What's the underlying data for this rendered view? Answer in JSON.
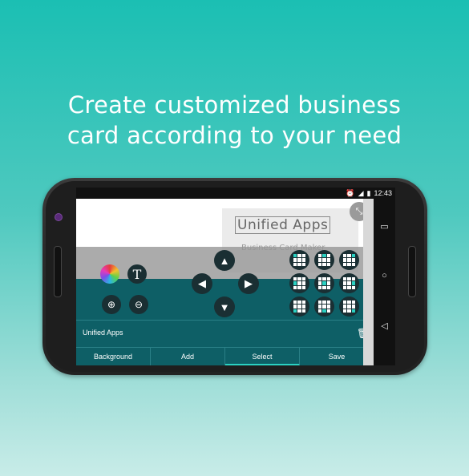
{
  "headline": {
    "line1": "Create customized business",
    "line2": "card according to your need"
  },
  "status": {
    "time": "12:43"
  },
  "card": {
    "title": "Unified Apps",
    "subtitle": "Business Card Maker"
  },
  "editor": {
    "text_label": "Unified Apps"
  },
  "tabs": [
    {
      "label": "Background"
    },
    {
      "label": "Add"
    },
    {
      "label": "Select"
    },
    {
      "label": "Save"
    }
  ],
  "colors": {
    "accent": "#2ad1c2",
    "panel": "#0e5f66",
    "bg_top": "#1bbfb3"
  },
  "icons": {
    "color": "color-wheel-icon",
    "text": "text-icon",
    "zoom_in": "zoom-in-icon",
    "zoom_out": "zoom-out-icon",
    "up": "arrow-up-icon",
    "down": "arrow-down-icon",
    "left": "arrow-left-icon",
    "right": "arrow-right-icon",
    "collapse": "collapse-icon",
    "trash": "trash-icon"
  }
}
